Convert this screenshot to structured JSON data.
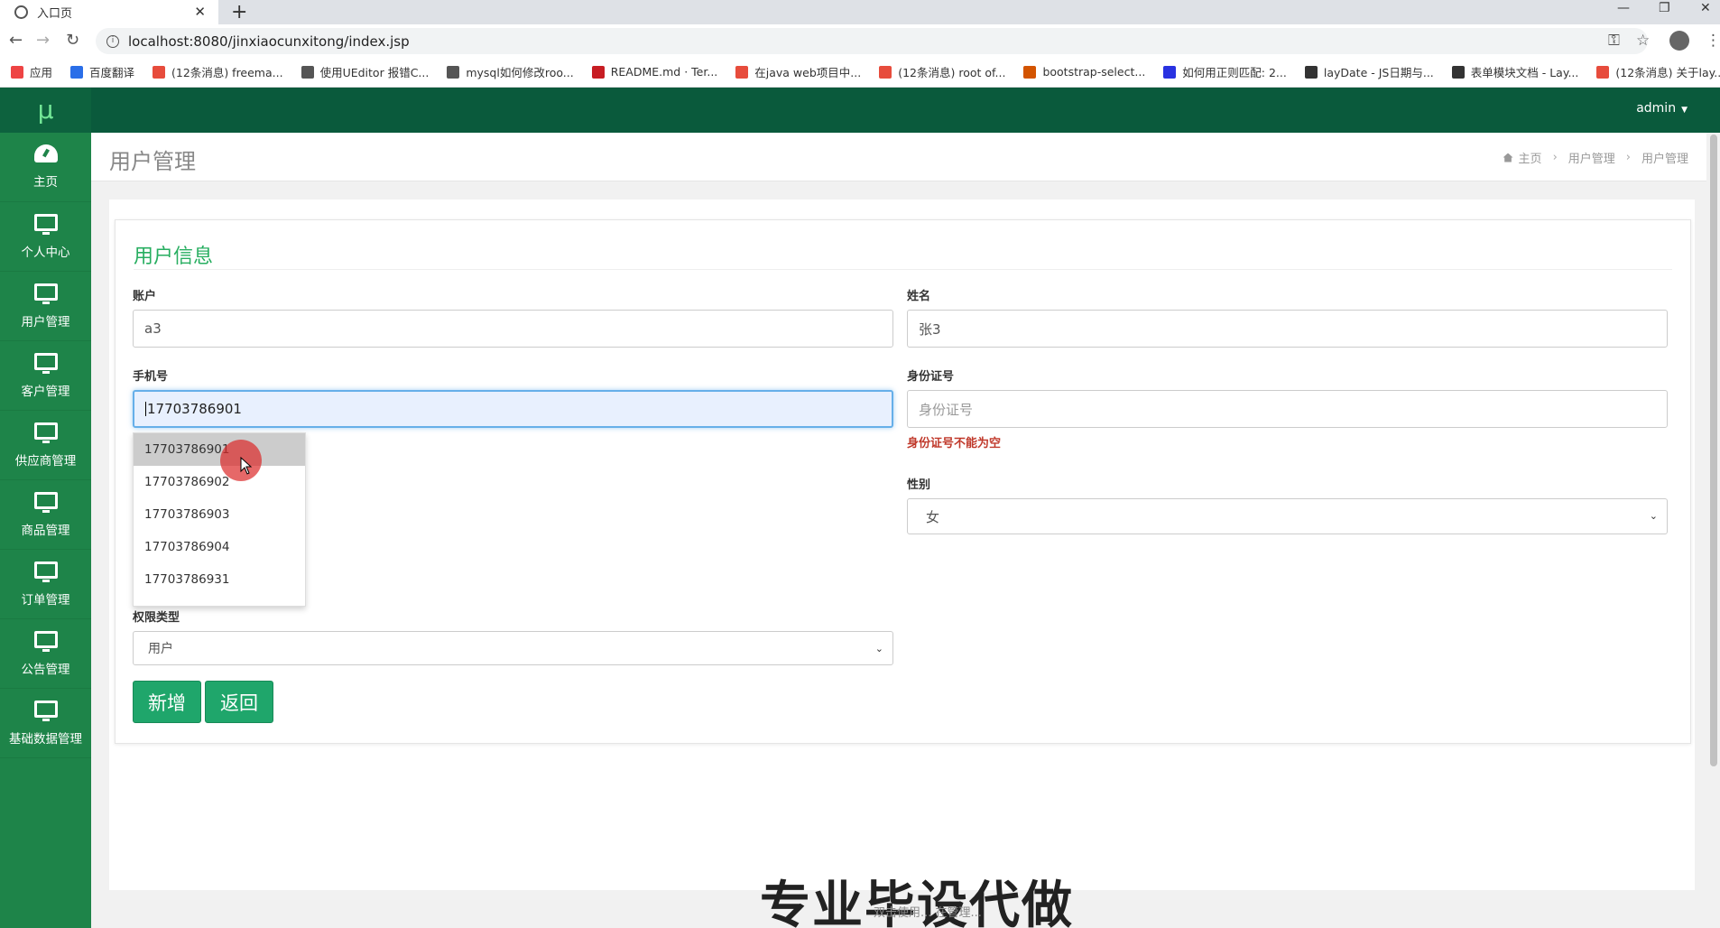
{
  "browser": {
    "tab_title": "入口页",
    "url": "localhost:8080/jinxiaocunxitong/index.jsp",
    "bookmarks": [
      {
        "label": "应用",
        "icon": "apps-icon",
        "color": "#e44"
      },
      {
        "label": "百度翻译",
        "icon": "baidu-translate-icon",
        "color": "#2a6ee8"
      },
      {
        "label": "(12条消息) freema...",
        "icon": "csdn-icon",
        "color": "#e74c3c"
      },
      {
        "label": "使用UEditor 报错C...",
        "icon": "link-icon",
        "color": "#555"
      },
      {
        "label": "mysql如何修改roo...",
        "icon": "link-icon",
        "color": "#555"
      },
      {
        "label": "README.md · Ter...",
        "icon": "gitee-icon",
        "color": "#c71d23"
      },
      {
        "label": "在java web项目中...",
        "icon": "csdn-icon",
        "color": "#e74c3c"
      },
      {
        "label": "(12条消息) root of...",
        "icon": "csdn-icon",
        "color": "#e74c3c"
      },
      {
        "label": "bootstrap-select...",
        "icon": "site-icon",
        "color": "#d35400"
      },
      {
        "label": "如何用正则匹配: 2...",
        "icon": "baidu-icon",
        "color": "#2932e1"
      },
      {
        "label": "layDate - JS日期与...",
        "icon": "layui-icon",
        "color": "#333"
      },
      {
        "label": "表单模块文档 - Lay...",
        "icon": "layui-icon",
        "color": "#333"
      },
      {
        "label": "(12条消息) 关于lay...",
        "icon": "csdn-icon",
        "color": "#e74c3c"
      }
    ]
  },
  "app": {
    "logo": "μ",
    "user": "admin",
    "sidebar": [
      {
        "label": "主页",
        "icon": "dashboard-icon"
      },
      {
        "label": "个人中心",
        "icon": "monitor-icon"
      },
      {
        "label": "用户管理",
        "icon": "monitor-icon"
      },
      {
        "label": "客户管理",
        "icon": "monitor-icon"
      },
      {
        "label": "供应商管理",
        "icon": "monitor-icon"
      },
      {
        "label": "商品管理",
        "icon": "monitor-icon"
      },
      {
        "label": "订单管理",
        "icon": "monitor-icon"
      },
      {
        "label": "公告管理",
        "icon": "monitor-icon"
      },
      {
        "label": "基础数据管理",
        "icon": "monitor-icon"
      }
    ],
    "page_title": "用户管理",
    "breadcrumb": [
      "主页",
      "用户管理",
      "用户管理"
    ]
  },
  "form": {
    "title": "用户信息",
    "account": {
      "label": "账户",
      "value": "a3"
    },
    "name": {
      "label": "姓名",
      "value": "张3"
    },
    "phone": {
      "label": "手机号",
      "value": "17703786901"
    },
    "id_card": {
      "label": "身份证号",
      "placeholder": "身份证号",
      "error": "身份证号不能为空"
    },
    "gender": {
      "label": "性别",
      "value": "女"
    },
    "role": {
      "label": "权限类型",
      "value": "用户"
    },
    "submit_label": "新增",
    "back_label": "返回"
  },
  "autocomplete": {
    "options": [
      "17703786901",
      "17703786902",
      "17703786903",
      "17703786904",
      "17703786931"
    ],
    "highlighted": 0
  },
  "overlay": {
    "watermark": "专业毕设代做",
    "subtitle": "双击使用... 在管理..."
  },
  "colors": {
    "sidebar": "#1e8449",
    "topbar": "#0a5a3c",
    "accent": "#27ae60",
    "button": "#1fa66b",
    "error": "#c0392b"
  }
}
